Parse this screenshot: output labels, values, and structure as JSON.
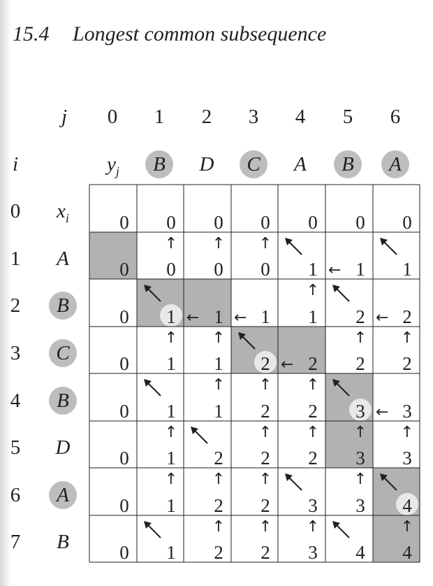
{
  "header": {
    "section_number": "15.4",
    "section_title": "Longest common subsequence"
  },
  "labels": {
    "j": "j",
    "i": "i",
    "yj_base": "y",
    "yj_sub": "j",
    "xi_base": "x",
    "xi_sub": "i"
  },
  "columns": {
    "indices": [
      "0",
      "1",
      "2",
      "3",
      "4",
      "5",
      "6"
    ],
    "y": [
      "B",
      "D",
      "C",
      "A",
      "B",
      "A"
    ],
    "y_circled": [
      true,
      false,
      true,
      false,
      true,
      true
    ]
  },
  "rows": {
    "indices": [
      "0",
      "1",
      "2",
      "3",
      "4",
      "5",
      "6",
      "7"
    ],
    "x": [
      "A",
      "B",
      "C",
      "B",
      "D",
      "A",
      "B"
    ],
    "x_circled": [
      false,
      true,
      true,
      true,
      false,
      true,
      false
    ]
  },
  "table": {
    "values": [
      [
        "0",
        "0",
        "0",
        "0",
        "0",
        "0",
        "0"
      ],
      [
        "0",
        "0",
        "0",
        "0",
        "1",
        "1",
        "1"
      ],
      [
        "0",
        "1",
        "1",
        "1",
        "1",
        "2",
        "2"
      ],
      [
        "0",
        "1",
        "1",
        "2",
        "2",
        "2",
        "2"
      ],
      [
        "0",
        "1",
        "1",
        "2",
        "2",
        "3",
        "3"
      ],
      [
        "0",
        "1",
        "2",
        "2",
        "2",
        "3",
        "3"
      ],
      [
        "0",
        "1",
        "2",
        "2",
        "3",
        "3",
        "4"
      ],
      [
        "0",
        "1",
        "2",
        "2",
        "3",
        "4",
        "4"
      ]
    ],
    "arrows": [
      [
        "",
        "",
        "",
        "",
        "",
        "",
        ""
      ],
      [
        "",
        "up",
        "up",
        "up",
        "diag",
        "left",
        "diag"
      ],
      [
        "",
        "diag",
        "left",
        "left",
        "up",
        "diag",
        "left"
      ],
      [
        "",
        "up",
        "up",
        "diag",
        "left",
        "up",
        "up"
      ],
      [
        "",
        "diag",
        "up",
        "up",
        "up",
        "diag",
        "left"
      ],
      [
        "",
        "up",
        "diag",
        "up",
        "up",
        "up",
        "up"
      ],
      [
        "",
        "up",
        "up",
        "up",
        "diag",
        "up",
        "diag"
      ],
      [
        "",
        "diag",
        "up",
        "up",
        "up",
        "diag",
        "up"
      ]
    ],
    "shaded_cells": [
      [
        1,
        0
      ],
      [
        2,
        1
      ],
      [
        2,
        2
      ],
      [
        3,
        3
      ],
      [
        3,
        4
      ],
      [
        4,
        5
      ],
      [
        5,
        5
      ],
      [
        6,
        6
      ],
      [
        7,
        6
      ]
    ],
    "circled_cells": [
      [
        2,
        1
      ],
      [
        3,
        3
      ],
      [
        4,
        5
      ],
      [
        6,
        6
      ]
    ]
  },
  "colors": {
    "shade": "#b2b2b2",
    "circle_label": "#bdbdbd",
    "circle_cell": "#e8e8e8",
    "ink": "#231f20"
  }
}
